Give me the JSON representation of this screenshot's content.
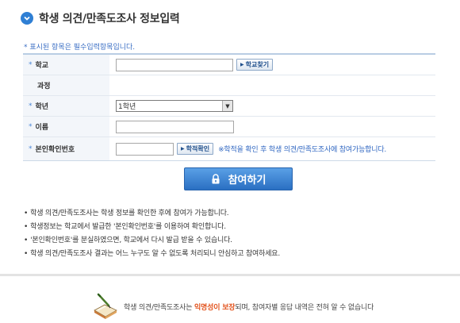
{
  "header": {
    "title": "학생 의견/만족도조사 정보입력",
    "icon": "chevron-down-circle-icon"
  },
  "notice": "* 표시된 항목은 필수입력항목입니다.",
  "form": {
    "school": {
      "label": "학교",
      "required_mark": "*",
      "value": "",
      "button": "학교찾기"
    },
    "course": {
      "label": "과정",
      "value": ""
    },
    "grade": {
      "label": "학년",
      "required_mark": "*",
      "selected": "1학년"
    },
    "name": {
      "label": "이름",
      "required_mark": "*",
      "value": ""
    },
    "student_id": {
      "label": "본인확인번호",
      "required_mark": "*",
      "value": "",
      "button": "학적확인",
      "help": "※학적을 확인 후 학생 의견/만족도조사에 참여가능합니다."
    }
  },
  "submit": {
    "label": "참여하기",
    "icon": "lock-icon"
  },
  "bullets": [
    "학생 의견/만족도조사는 학생 정보를 확인한 후에 참여가 가능합니다.",
    "학생정보는 학교에서 발급한 '본인확인번호'를 이용하여 확인합니다.",
    "'본인확인번호'를 분실하였으면, 학교에서 다시 발급 받을 수 있습니다.",
    "학생 의견/만족도조사 결과는 어느 누구도 알 수 없도록 처리되니 안심하고 참여하세요."
  ],
  "bullet_mark": "•",
  "footer": {
    "icon": "book-pen-icon",
    "text_before": "학생 의견/만족도조사는 ",
    "highlight": "익명성이 보장",
    "text_after": "되며, 참여자별 응답 내역은 전혀 알 수 없습니다"
  },
  "colors": {
    "accent": "#2f7fd4",
    "notice": "#3a6ec4",
    "highlight": "#e2541e",
    "button": "#2a6fc2"
  }
}
